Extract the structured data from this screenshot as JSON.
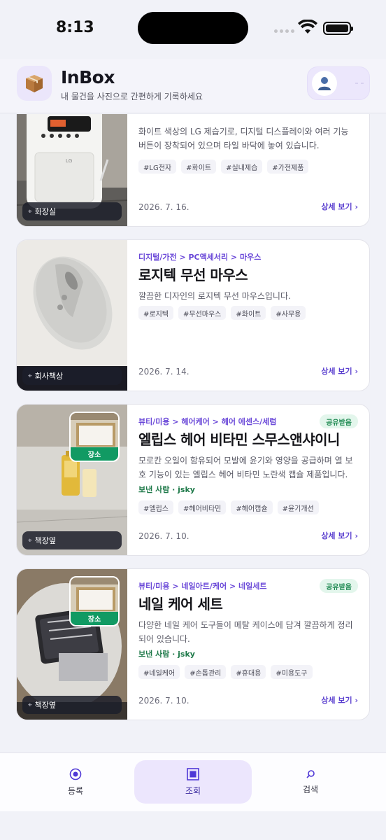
{
  "status_bar": {
    "time": "8:13"
  },
  "header": {
    "logo_icon": "package-box-icon",
    "title": "InBox",
    "subtitle": "내 물건을 사진으로 간편하게 기록하세요",
    "profile_icon": "user-avatar-icon"
  },
  "items": [
    {
      "category": "",
      "title": "",
      "description": "화이트 색상의 LG 제습기로, 디지털 디스플레이와 여러 기능 버튼이 장착되어 있으며 타일 바닥에 놓여 있습니다.",
      "tags": [
        "#LG전자",
        "#화이트",
        "#실내제습",
        "#가전제품"
      ],
      "place": "화장실",
      "date": "2026. 7. 16.",
      "detail_label": "상세 보기 ›",
      "thumb_text": "LG"
    },
    {
      "category": "디지털/가전 > PC액세서리 > 마우스",
      "title": "로지텍 무선 마우스",
      "description": "깔끔한 디자인의 로지텍 무선 마우스입니다.",
      "tags": [
        "#로지텍",
        "#무선마우스",
        "#화이트",
        "#사무용"
      ],
      "place": "회사책상",
      "date": "2026. 7. 14.",
      "detail_label": "상세 보기 ›"
    },
    {
      "category": "뷰티/미용 > 헤어케어 > 헤어 에센스/세럼",
      "badge": "공유받음",
      "title": "엘립스 헤어 비타민 스무스앤샤이니",
      "description": "모로칸 오일이 함유되어 모발에 윤기와 영양을 공급하며 열 보호 기능이 있는 엘립스 헤어 비타민 노란색 캡슐 제품입니다.",
      "sender": "보낸 사람 · jsky",
      "tags": [
        "#엘립스",
        "#헤어비타민",
        "#헤어캡슐",
        "#윤기개선"
      ],
      "inset_label": "장소",
      "place": "책장옆",
      "date": "2026. 7. 10.",
      "detail_label": "상세 보기 ›"
    },
    {
      "category": "뷰티/미용 > 네일아트/케어 > 네일세트",
      "badge": "공유받음",
      "title": "네일 케어 세트",
      "description": "다양한 네일 케어 도구들이 메탈 케이스에 담겨 깔끔하게 정리되어 있습니다.",
      "sender": "보낸 사람 · jsky",
      "tags": [
        "#네일케어",
        "#손톱관리",
        "#휴대용",
        "#미용도구"
      ],
      "inset_label": "장소",
      "place": "책장옆",
      "date": "2026. 7. 10.",
      "detail_label": "상세 보기 ›"
    }
  ],
  "nav": [
    {
      "label": "등록",
      "icon": "record-icon"
    },
    {
      "label": "조회",
      "icon": "square-icon",
      "active": true
    },
    {
      "label": "검색",
      "icon": "search-icon"
    }
  ],
  "colors": {
    "accent": "#5a3fcf",
    "shared": "#1f8a52",
    "inset_tag": "#119a63"
  }
}
